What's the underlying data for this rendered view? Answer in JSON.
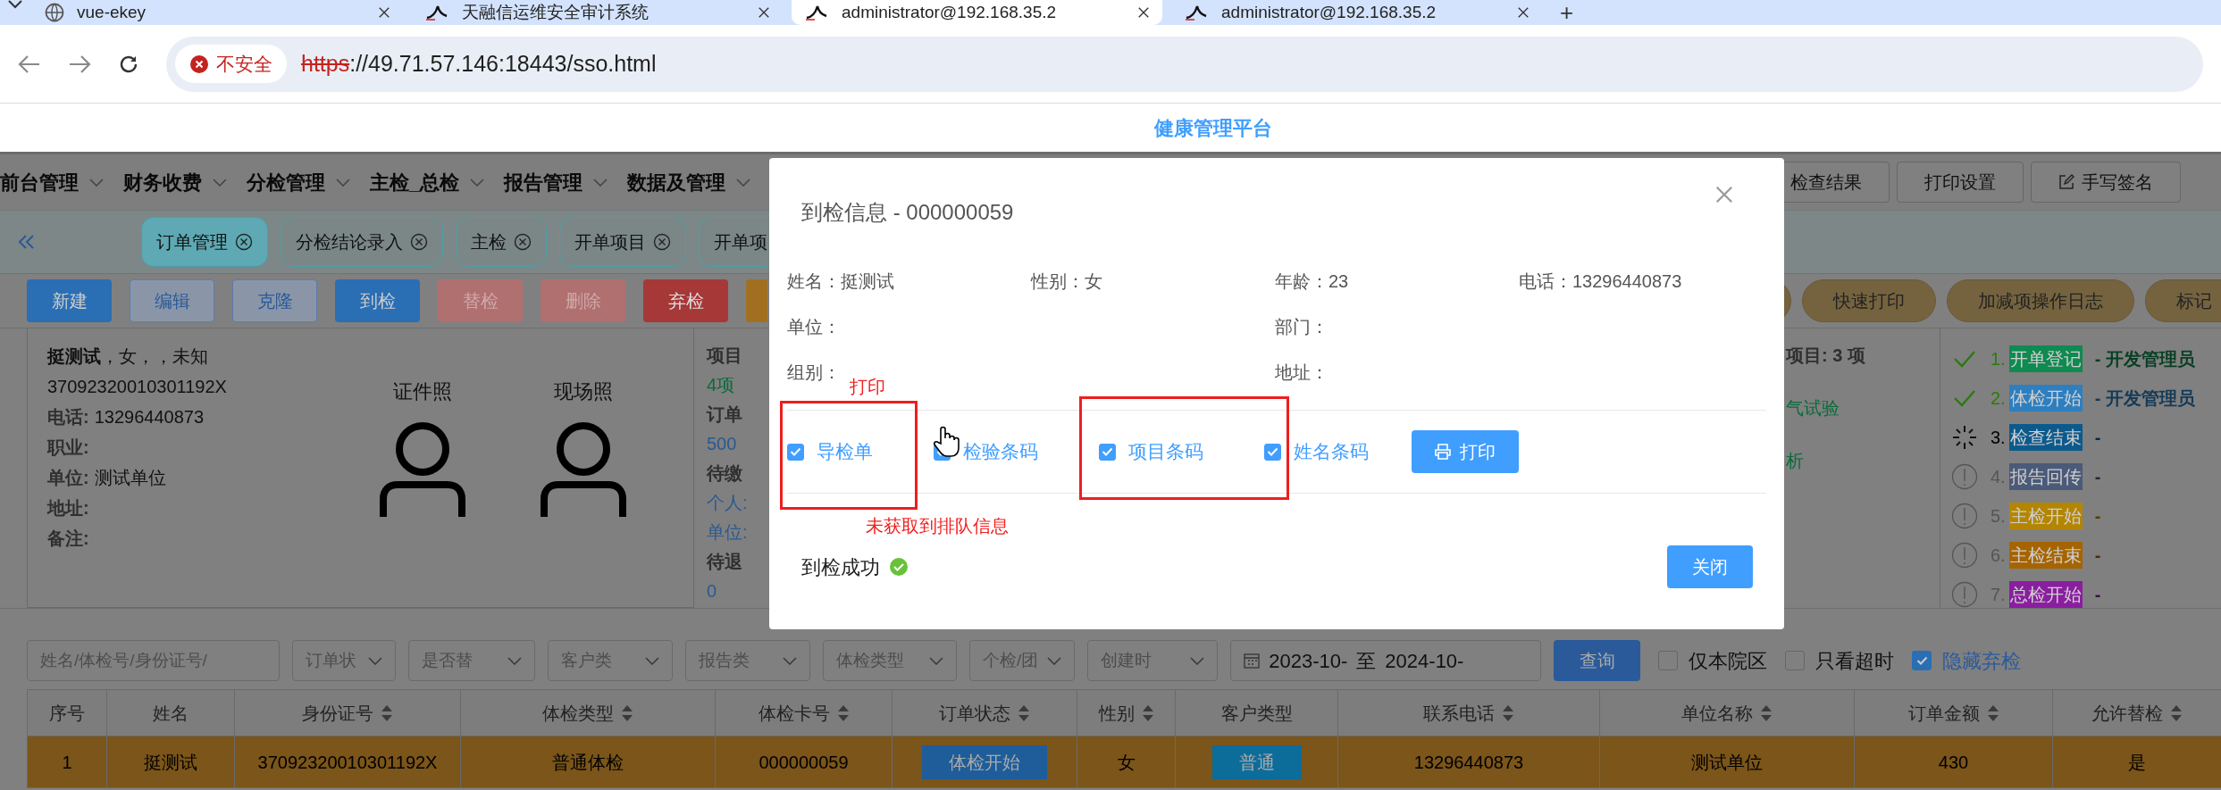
{
  "browser": {
    "tabs": [
      {
        "title": "vue-ekey",
        "kind": "globe",
        "selected": false
      },
      {
        "title": "天融信运维安全审计系统",
        "kind": "logo",
        "selected": false
      },
      {
        "title": "administrator@192.168.35.2",
        "kind": "logo",
        "selected": true
      },
      {
        "title": "administrator@192.168.35.2",
        "kind": "logo",
        "selected": false
      }
    ],
    "new_tab": "+",
    "security_label": "不安全",
    "url_scheme": "https",
    "url_rest": "://49.71.57.146:18443/sso.html"
  },
  "app": {
    "title": "健康管理平台",
    "menu": [
      "前台管理",
      "财务收费",
      "分检管理",
      "主检_总检",
      "报告管理",
      "数据及管理"
    ],
    "toolbar_buttons": [
      {
        "label": "检查结果",
        "kind": "plain"
      },
      {
        "label": "打印设置",
        "kind": "plain"
      },
      {
        "label": "手写签名",
        "kind": "edit"
      }
    ],
    "page_tabs": [
      {
        "label": "订单管理",
        "selected": true,
        "closable": true
      },
      {
        "label": "分检结论录入",
        "selected": false,
        "closable": true
      },
      {
        "label": "主检",
        "selected": false,
        "closable": true
      },
      {
        "label": "开单项目",
        "selected": false,
        "closable": true
      },
      {
        "label": "开单项",
        "selected": false,
        "closable": false
      }
    ],
    "actions": [
      {
        "label": "新建",
        "kind": "primary"
      },
      {
        "label": "编辑",
        "kind": "plain"
      },
      {
        "label": "克隆",
        "kind": "plain"
      },
      {
        "label": "到检",
        "kind": "primary"
      },
      {
        "label": "替检",
        "kind": "danger-disabled"
      },
      {
        "label": "删除",
        "kind": "danger-disabled"
      },
      {
        "label": "弃检",
        "kind": "danger"
      },
      {
        "kind": "warning"
      }
    ],
    "side_actions": [
      {
        "kind": "stub"
      },
      {
        "label": "快速打印",
        "kind": "pill"
      },
      {
        "label": "加减项操作日志",
        "kind": "pill"
      },
      {
        "label": "标记",
        "kind": "pill"
      }
    ],
    "patient": {
      "summary": "**挺测试**，女，，未知",
      "id_number": "37092320010301192X",
      "fields": [
        {
          "label": "电话:",
          "value": "13296440873"
        },
        {
          "label": "职业:"
        },
        {
          "label": "单位:",
          "value": "测试单位"
        },
        {
          "label": "地址:"
        },
        {
          "label": "备注:"
        }
      ],
      "photos": [
        {
          "caption": "证件照"
        },
        {
          "caption": "现场照"
        }
      ]
    },
    "summary_left": [
      {
        "text": "项目",
        "kind": "label"
      },
      {
        "text": "4项",
        "kind": "green"
      },
      {
        "text": "订单",
        "kind": "label"
      },
      {
        "text": "500",
        "kind": "blue"
      },
      {
        "text": "待缴",
        "kind": "label"
      },
      {
        "text": "个人:",
        "kind": "blue"
      },
      {
        "text": "单位:",
        "kind": "blue"
      },
      {
        "text": "待退",
        "kind": "label"
      },
      {
        "text": "0",
        "kind": "blue"
      }
    ],
    "summary_right": [
      {
        "text": "项目: 3 项",
        "kind": "label"
      },
      {
        "text": "气试验",
        "kind": "green"
      },
      {
        "text": "析",
        "kind": "green"
      }
    ],
    "timeline": [
      {
        "number": "1.",
        "stage": "开单登记",
        "operator": "- 开发管理员",
        "kind": "done",
        "color": "#0f8a50"
      },
      {
        "number": "2.",
        "stage": "体检开始",
        "operator": "- 开发管理员",
        "kind": "done",
        "color": "#2d7fc0"
      },
      {
        "number": "3.",
        "stage": "检查结束",
        "operator": "-",
        "kind": "current",
        "color": "#0c5a8c"
      },
      {
        "number": "4.",
        "stage": "报告回传",
        "operator": "-",
        "kind": "pending",
        "color": "#4a5a78"
      },
      {
        "number": "5.",
        "stage": "主检开始",
        "operator": "-",
        "kind": "pending",
        "color": "#b48600"
      },
      {
        "number": "6.",
        "stage": "主检结束",
        "operator": "-",
        "kind": "pending",
        "color": "#a66400"
      },
      {
        "number": "7.",
        "stage": "总检开始",
        "operator": "-",
        "kind": "pending",
        "color": "#8a1ea0"
      }
    ],
    "filter": {
      "search_placeholder": "姓名/体检号/身份证号/",
      "selects": [
        "订单状",
        "是否替",
        "客户类",
        "报告类",
        "体检类型",
        "个检/团",
        "创建时"
      ],
      "date_from": "2023-10-",
      "date_separator": "至",
      "date_to": "2024-10-",
      "query_button": "查询",
      "toggles": [
        {
          "label": "仅本院区",
          "checked": false
        },
        {
          "label": "只看超时",
          "checked": false
        },
        {
          "label": "隐藏弃检",
          "checked": true
        }
      ]
    },
    "table": {
      "columns": [
        {
          "label": "序号",
          "sortable": false
        },
        {
          "label": "姓名",
          "sortable": false
        },
        {
          "label": "身份证号",
          "sortable": true
        },
        {
          "label": "体检类型",
          "sortable": true
        },
        {
          "label": "体检卡号",
          "sortable": true
        },
        {
          "label": "订单状态",
          "sortable": true
        },
        {
          "label": "性别",
          "sortable": true
        },
        {
          "label": "客户类型",
          "sortable": false
        },
        {
          "label": "联系电话",
          "sortable": true
        },
        {
          "label": "单位名称",
          "sortable": true
        },
        {
          "label": "订单金额",
          "sortable": true
        },
        {
          "label": "允许替检",
          "sortable": true
        }
      ],
      "rows": [
        {
          "selected": true,
          "cells": [
            {
              "text": "1",
              "kind": "text"
            },
            {
              "text": "挺测试",
              "kind": "text"
            },
            {
              "text": "37092320010301192X",
              "kind": "text"
            },
            {
              "text": "普通体检",
              "kind": "text"
            },
            {
              "text": "000000059",
              "kind": "text"
            },
            {
              "text": "体检开始",
              "kind": "status-tag"
            },
            {
              "text": "女",
              "kind": "text"
            },
            {
              "text": "普通",
              "kind": "type-tag"
            },
            {
              "text": "13296440873",
              "kind": "text"
            },
            {
              "text": "测试单位",
              "kind": "text"
            },
            {
              "text": "430",
              "kind": "text"
            },
            {
              "text": "是",
              "kind": "text"
            }
          ]
        }
      ]
    }
  },
  "modal": {
    "title": "到检信息 - 000000059",
    "info_rows": [
      [
        {
          "label": "姓名：",
          "value": "挺测试"
        },
        {
          "label": "性别：",
          "value": "女"
        },
        {
          "label": "年龄：",
          "value": "23"
        },
        {
          "label": "电话：",
          "value": "13296440873"
        }
      ],
      [
        {
          "label": "单位："
        },
        null,
        {
          "label": "部门："
        },
        null
      ],
      [
        {
          "label": "组别："
        },
        null,
        {
          "label": "地址："
        },
        null
      ]
    ],
    "print_options": [
      {
        "label": "导检单",
        "checked": true
      },
      {
        "label": "检验条码",
        "checked": true
      },
      {
        "label": "项目条码",
        "checked": true
      },
      {
        "label": "姓名条码",
        "checked": true
      }
    ],
    "print_button": "打印",
    "result": "到检成功",
    "close_button": "关闭",
    "annotations": [
      {
        "text": "打印"
      },
      {
        "text": "未获取到排队信息"
      }
    ]
  }
}
